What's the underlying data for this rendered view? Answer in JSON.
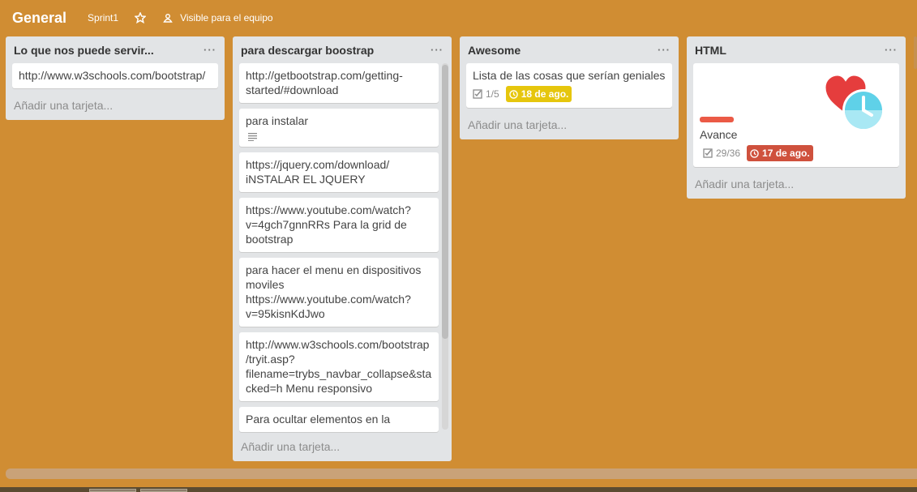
{
  "header": {
    "title": "General",
    "sprint_label": "Sprint1",
    "visibility_label": "Visible para el equipo"
  },
  "lists": [
    {
      "title": "Lo que nos puede servir...",
      "menu": "···",
      "cards": [
        {
          "text": "http://www.w3schools.com/bootstrap/"
        }
      ],
      "add_label": "Añadir una tarjeta..."
    },
    {
      "title": "para descargar boostrap",
      "menu": "···",
      "cards": [
        {
          "text": "http://getbootstrap.com/getting-started/#download"
        },
        {
          "text": "para instalar"
        },
        {
          "text": "https://jquery.com/download/ iNSTALAR EL JQUERY"
        },
        {
          "text": "https://www.youtube.com/watch?v=4gch7gnnRRs Para la grid de bootstrap"
        },
        {
          "text": "para hacer el menu en dispositivos moviles https://www.youtube.com/watch?v=95kisnKdJwo"
        },
        {
          "text": "http://www.w3schools.com/bootstrap/tryit.asp?filename=trybs_navbar_collapse&stacked=h Menu responsivo"
        },
        {
          "text": "Para ocultar elementos en la"
        }
      ],
      "add_label": "Añadir una tarjeta..."
    },
    {
      "title": "Awesome",
      "menu": "···",
      "cards": [
        {
          "text": "Lista de las cosas que serían geniales",
          "checklist": "1/5",
          "due": "18 de ago."
        }
      ],
      "add_label": "Añadir una tarjeta..."
    },
    {
      "title": "HTML",
      "menu": "···",
      "cards": [
        {
          "text": "Avance",
          "checklist": "29/36",
          "due": "17 de ago."
        }
      ],
      "add_label": "Añadir una tarjeta..."
    }
  ],
  "colors": {
    "board_bg": "#d08d33",
    "due_soon": "#e6c60d",
    "due_overdue": "#cf513d",
    "label_red": "#eb5a46"
  }
}
